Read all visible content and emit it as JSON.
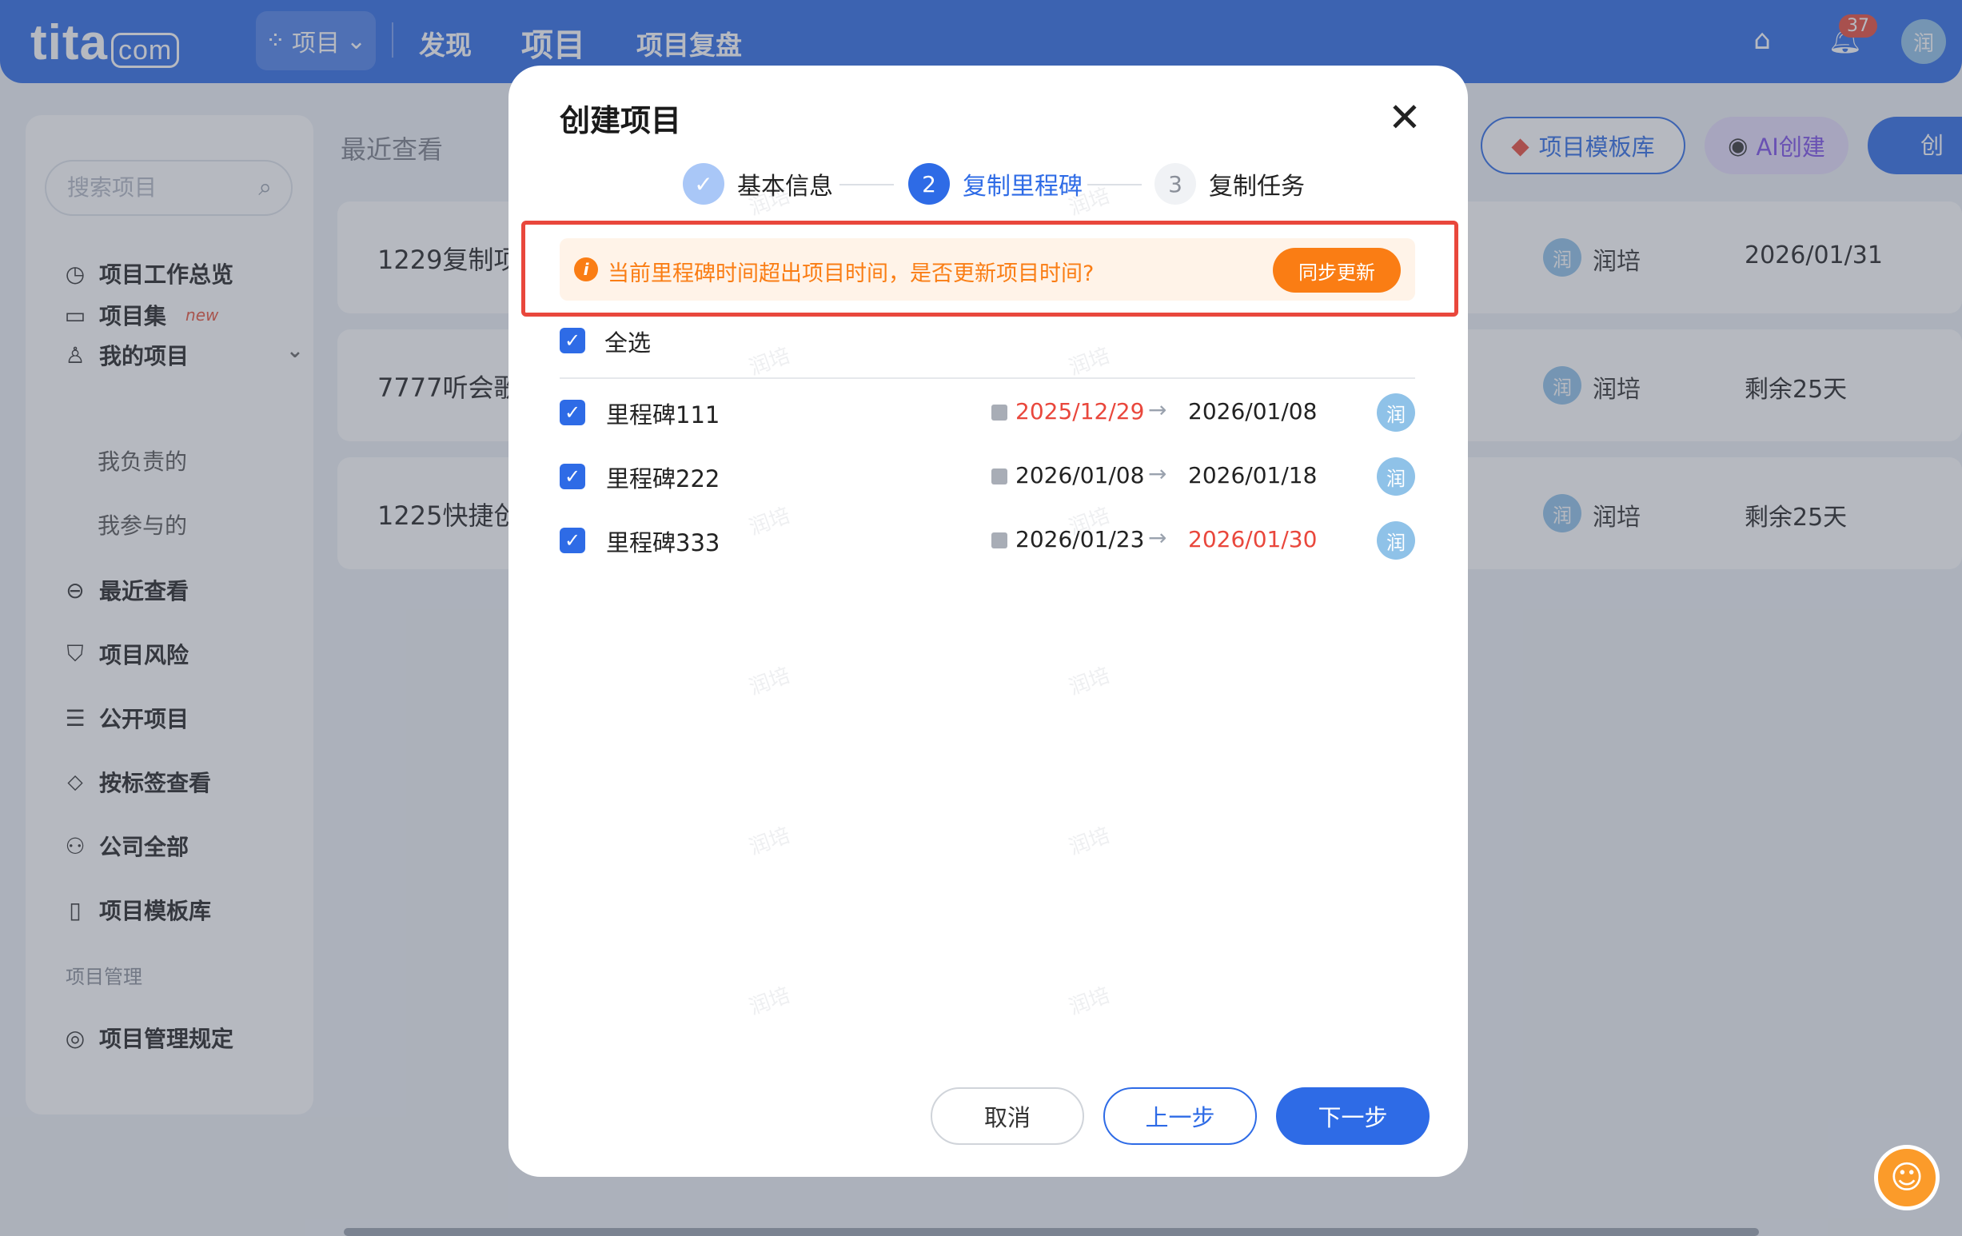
{
  "topbar": {
    "logo": "tita",
    "logo_suffix": "com",
    "switcher_label": "项目",
    "nav": [
      "发现",
      "项目",
      "项目复盘"
    ],
    "notification_count": "37",
    "avatar": "润"
  },
  "sidebar": {
    "search_placeholder": "搜索项目",
    "items": [
      {
        "label": "项目工作总览",
        "icon": "dashboard-icon"
      },
      {
        "label": "项目集",
        "icon": "folder-icon",
        "tag": "new"
      },
      {
        "label": "我的项目",
        "icon": "user-icon"
      },
      {
        "label": "最近查看",
        "icon": "recent-icon"
      },
      {
        "label": "项目风险",
        "icon": "shield-icon"
      },
      {
        "label": "公开项目",
        "icon": "list-icon"
      },
      {
        "label": "按标签查看",
        "icon": "tag-icon"
      },
      {
        "label": "公司全部",
        "icon": "org-icon"
      },
      {
        "label": "项目模板库",
        "icon": "template-icon"
      },
      {
        "label": "项目管理规定",
        "icon": "rule-icon"
      }
    ],
    "sub_items": [
      "我负责的",
      "我参与的"
    ],
    "group_label": "项目管理"
  },
  "main": {
    "section_title": "最近查看",
    "template_button": "项目模板库",
    "ai_button": "AI创建",
    "create_button": "创",
    "rows": [
      {
        "name": "1229复制项",
        "owner": "润培",
        "owner_avatar": "润",
        "date": "2026/01/31"
      },
      {
        "name": "7777听会歌",
        "owner": "润培",
        "owner_avatar": "润",
        "date": "剩余25天"
      },
      {
        "name": "1225快捷创",
        "owner": "润培",
        "owner_avatar": "润",
        "date": "剩余25天"
      }
    ]
  },
  "modal": {
    "title": "创建项目",
    "steps": [
      {
        "num": "✓",
        "label": "基本信息"
      },
      {
        "num": "2",
        "label": "复制里程碑"
      },
      {
        "num": "3",
        "label": "复制任务"
      }
    ],
    "warning": {
      "text": "当前里程碑时间超出项目时间，是否更新项目时间?",
      "button": "同步更新"
    },
    "select_all": "全选",
    "milestones": [
      {
        "name": "里程碑111",
        "start": "2025/12/29",
        "end": "2026/01/08",
        "avatar": "润",
        "start_over": true,
        "end_over": false
      },
      {
        "name": "里程碑222",
        "start": "2026/01/08",
        "end": "2026/01/18",
        "avatar": "润",
        "start_over": false,
        "end_over": false
      },
      {
        "name": "里程碑333",
        "start": "2026/01/23",
        "end": "2026/01/30",
        "avatar": "润",
        "start_over": false,
        "end_over": true
      }
    ],
    "buttons": {
      "cancel": "取消",
      "prev": "上一步",
      "next": "下一步"
    }
  },
  "watermark": "润培",
  "colors": {
    "primary": "#2e6be6",
    "warning": "#fa7d14",
    "danger": "#e9473c"
  }
}
